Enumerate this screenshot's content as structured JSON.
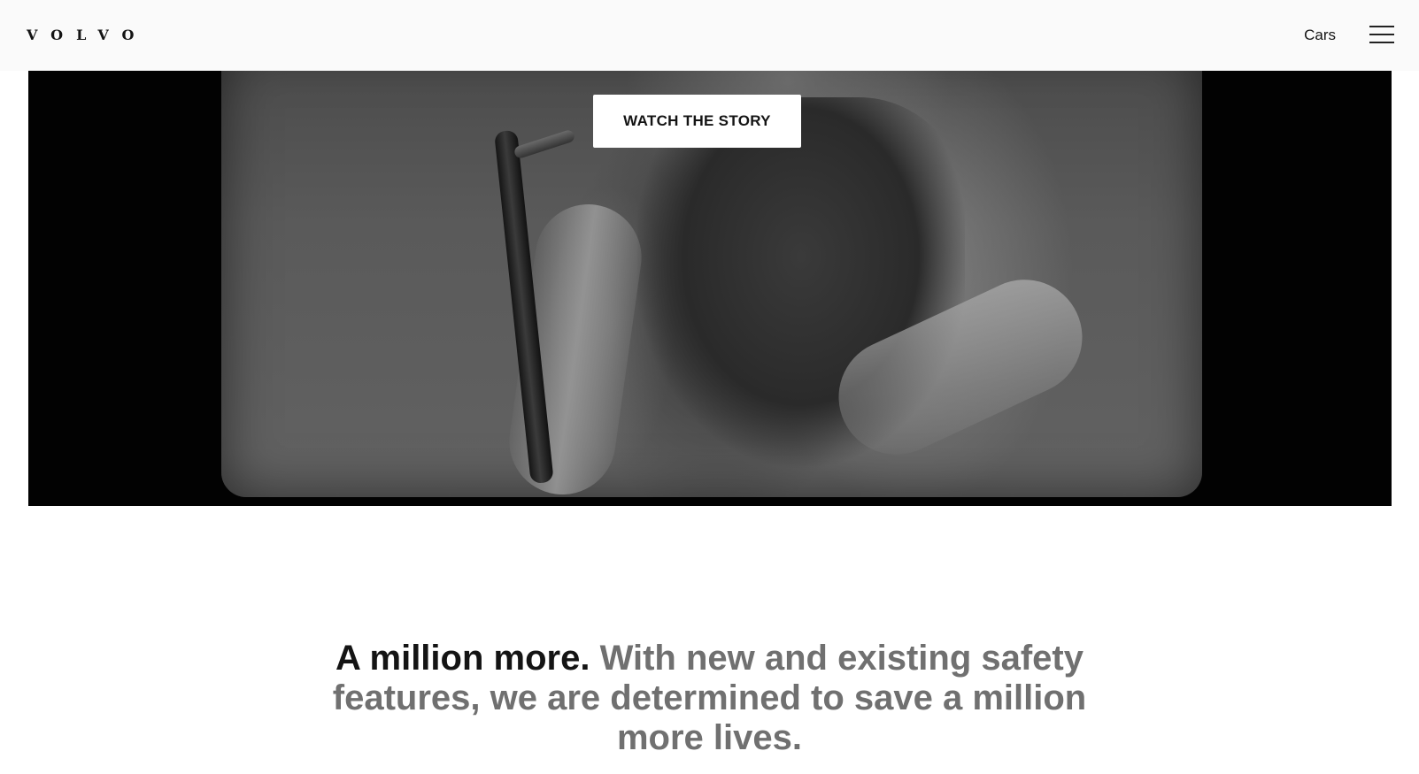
{
  "header": {
    "logo": "VOLVO",
    "nav_cars": "Cars",
    "menu_icon": "hamburger-menu-icon"
  },
  "hero": {
    "cta_label": "WATCH THE STORY"
  },
  "headline": {
    "lead": "A million more.",
    "rest": "With new and existing safety features, we are determined to save a million more lives."
  },
  "colors": {
    "header_bg": "#fafafa",
    "text_primary": "#141414",
    "text_secondary": "#707070",
    "button_bg": "#ffffff"
  }
}
